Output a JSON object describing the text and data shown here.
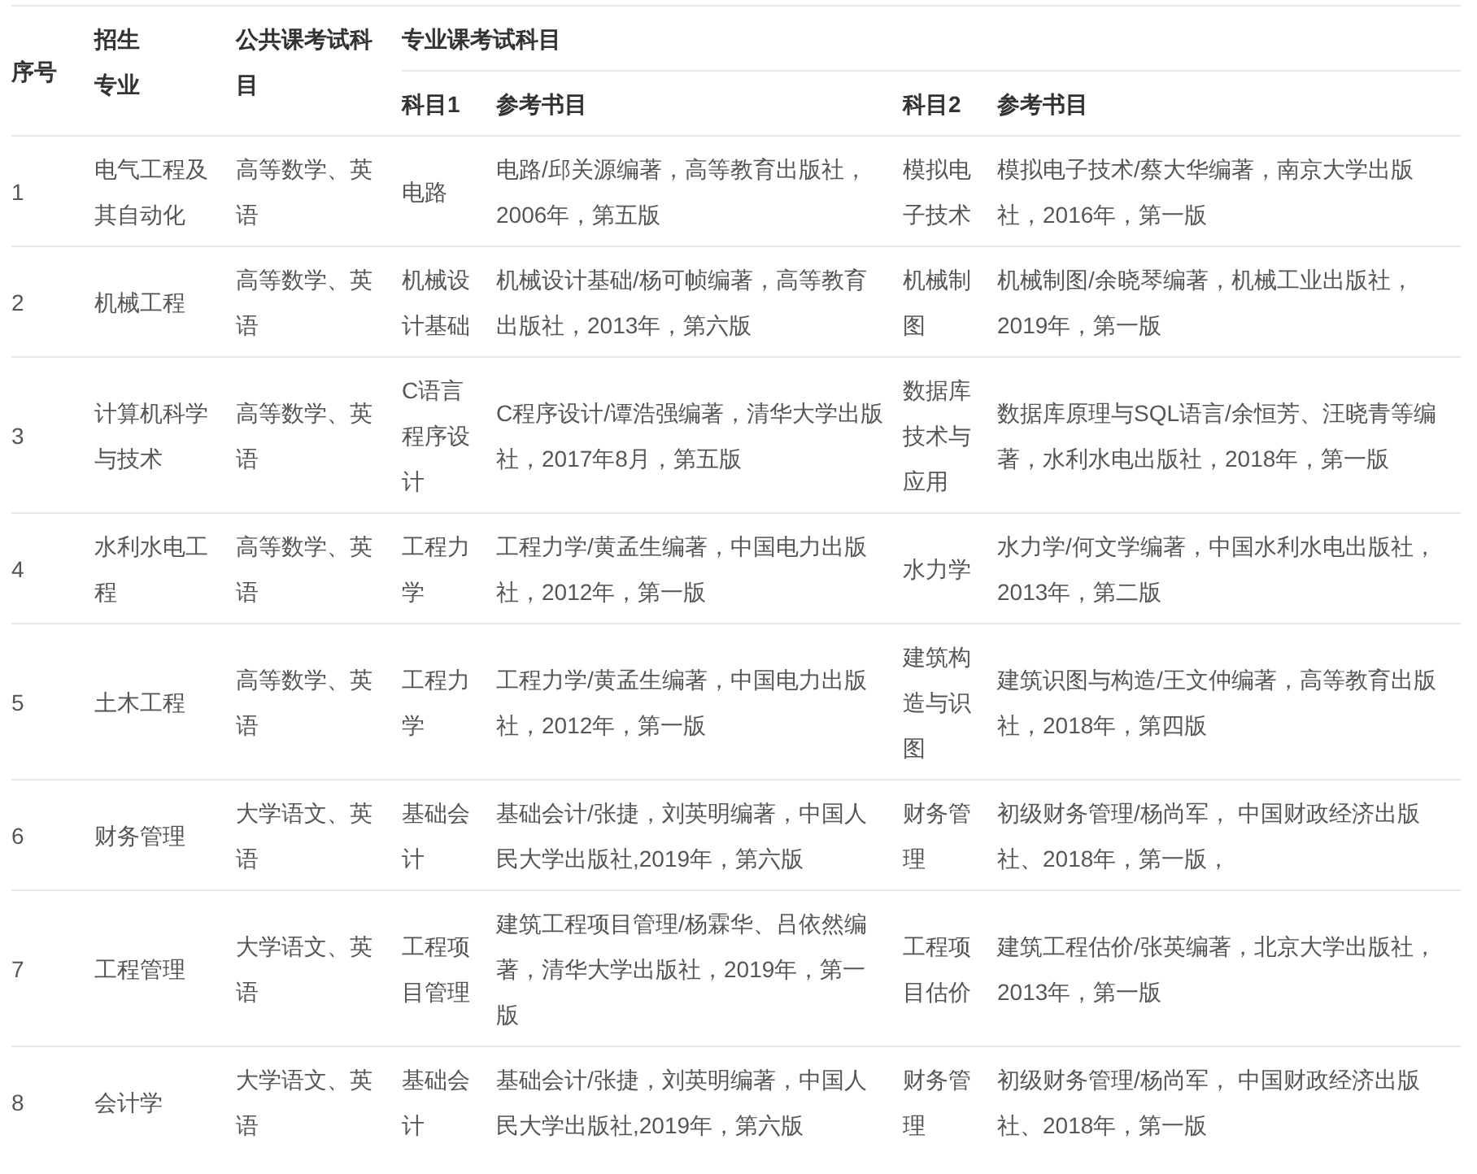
{
  "table": {
    "header": {
      "index": "序号",
      "major": [
        "招生",
        "专业"
      ],
      "public_exam": "公共课考试科目",
      "professional_exam": "专业课考试科目",
      "subject_1": "科目1",
      "books_1": "参考书目",
      "subject_2": "科目2",
      "books_2": "参考书目"
    },
    "rows": [
      {
        "index": "1",
        "major": "电气工程及其自动化",
        "public_exam": "高等数学、英语",
        "subject_1": "电路",
        "books_1": "电路/邱关源编著，高等教育出版社，2006年，第五版",
        "subject_2": "模拟电子技术",
        "books_2": "模拟电子技术/蔡大华编著，南京大学出版社，2016年，第一版"
      },
      {
        "index": "2",
        "major": "机械工程",
        "public_exam": "高等数学、英语",
        "subject_1": "机械设计基础",
        "books_1": "机械设计基础/杨可帧编著，高等教育出版社，2013年，第六版",
        "subject_2": "机械制图",
        "books_2": "机械制图/余晓琴编著，机械工业出版社，2019年，第一版"
      },
      {
        "index": "3",
        "major": "计算机科学与技术",
        "public_exam": "高等数学、英语",
        "subject_1": "C语言程序设计",
        "books_1": "C程序设计/谭浩强编著，清华大学出版社，2017年8月，第五版",
        "subject_2": "数据库技术与应用",
        "books_2": "数据库原理与SQL语言/余恒芳、汪晓青等编著，水利水电出版社，2018年，第一版"
      },
      {
        "index": "4",
        "major": "水利水电工程",
        "public_exam": "高等数学、英语",
        "subject_1": "工程力学",
        "books_1": "工程力学/黄孟生编著，中国电力出版社，2012年，第一版",
        "subject_2": "水力学",
        "books_2": "水力学/何文学编著，中国水利水电出版社，2013年，第二版"
      },
      {
        "index": "5",
        "major": "土木工程",
        "public_exam": "高等数学、英语",
        "subject_1": "工程力学",
        "books_1": "工程力学/黄孟生编著，中国电力出版社，2012年，第一版",
        "subject_2": "建筑构造与识图",
        "books_2": "建筑识图与构造/王文仲编著，高等教育出版社，2018年，第四版"
      },
      {
        "index": "6",
        "major": "财务管理",
        "public_exam": "大学语文、英语",
        "subject_1": "基础会计",
        "books_1": "基础会计/张捷，刘英明编著，中国人民大学出版社,2019年，第六版",
        "subject_2": "财务管理",
        "books_2": "初级财务管理/杨尚军， 中国财政经济出版社、2018年，第一版，"
      },
      {
        "index": "7",
        "major": "工程管理",
        "public_exam": "大学语文、英语",
        "subject_1": "工程项目管理",
        "books_1": "建筑工程项目管理/杨霖华、吕依然编著，清华大学出版社，2019年，第一版",
        "subject_2": "工程项目估价",
        "books_2": "建筑工程估价/张英编著，北京大学出版社，2013年，第一版"
      },
      {
        "index": "8",
        "major": "会计学",
        "public_exam": "大学语文、英语",
        "subject_1": "基础会计",
        "books_1": "基础会计/张捷，刘英明编著，中国人民大学出版社,2019年，第六版",
        "subject_2": "财务管理",
        "books_2": "初级财务管理/杨尚军， 中国财政经济出版社、2018年，第一版"
      }
    ]
  }
}
